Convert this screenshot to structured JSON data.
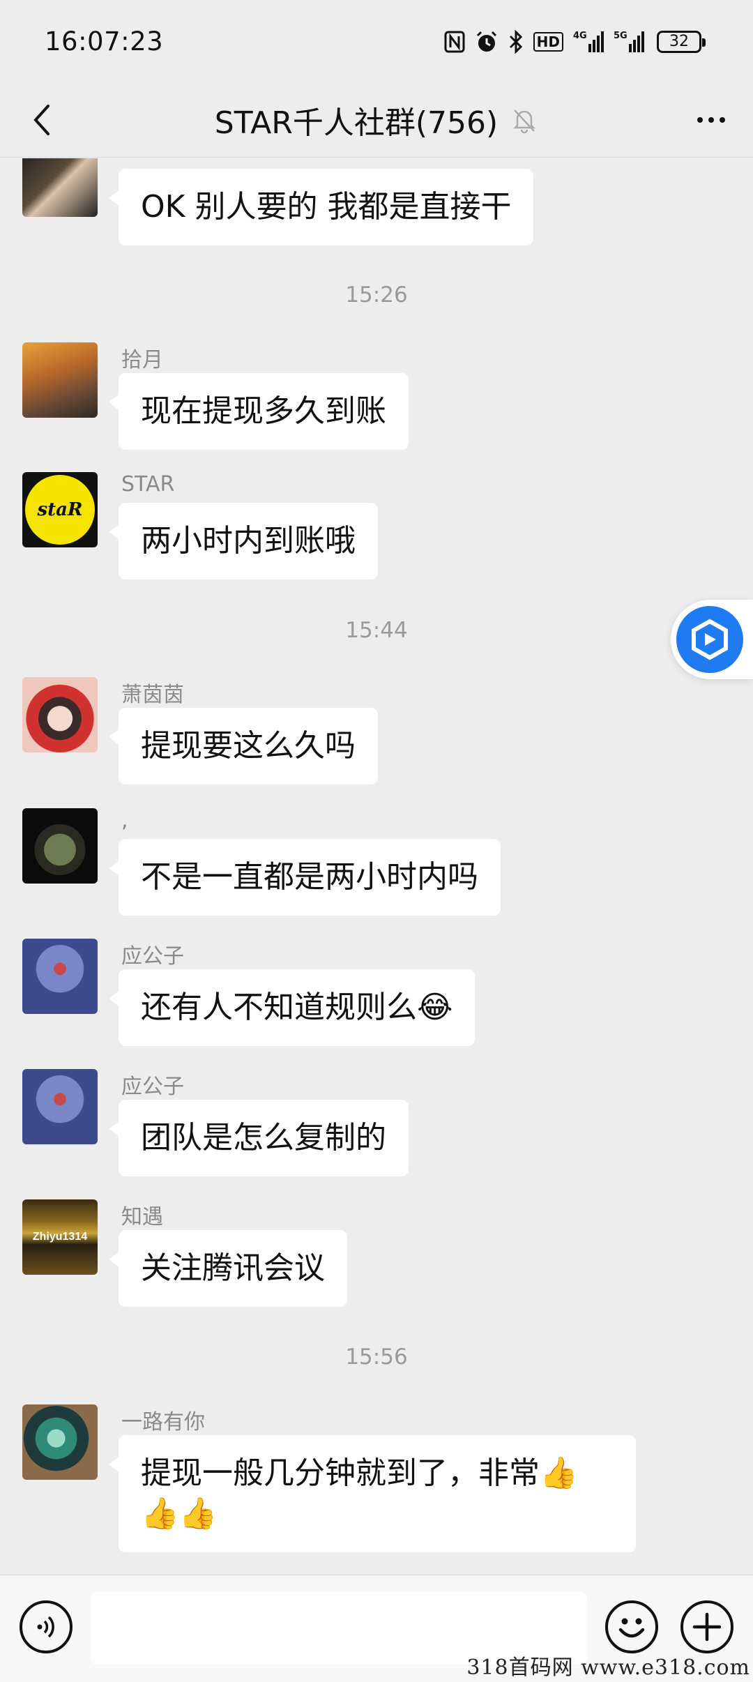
{
  "status_bar": {
    "time": "16:07:23",
    "network_4g": "4G",
    "network_5g": "5G",
    "hd_badge": "HD",
    "battery": "32"
  },
  "header": {
    "title": "STAR千人社群(756)"
  },
  "messages": [
    {
      "type": "message",
      "sender": "",
      "text": "OK  别人要的  我都是直接干"
    },
    {
      "type": "time",
      "text": "15:26"
    },
    {
      "type": "message",
      "sender": "拾月",
      "text": "现在提现多久到账"
    },
    {
      "type": "message",
      "sender": "STAR",
      "text": "两小时内到账哦",
      "avatar_text": "staR"
    },
    {
      "type": "time",
      "text": "15:44"
    },
    {
      "type": "message",
      "sender": "萧茵茵",
      "text": "提现要这么久吗"
    },
    {
      "type": "message",
      "sender": ",",
      "text": "不是一直都是两小时内吗"
    },
    {
      "type": "message",
      "sender": "应公子",
      "text": "还有人不知道规则么😂"
    },
    {
      "type": "message",
      "sender": "应公子",
      "text": "团队是怎么复制的"
    },
    {
      "type": "message",
      "sender": "知遇",
      "text": "关注腾讯会议",
      "avatar_text": "Zhiyu1314"
    },
    {
      "type": "time",
      "text": "15:56"
    },
    {
      "type": "message",
      "sender": "一路有你",
      "text": "提现一般几分钟就到了，非常👍👍👍"
    }
  ],
  "input_bar": {
    "placeholder": ""
  },
  "watermark": "318首码网  www.e318.com",
  "colors": {
    "background": "#ededed",
    "bubble": "#ffffff",
    "float_button": "#1f7bf2"
  }
}
